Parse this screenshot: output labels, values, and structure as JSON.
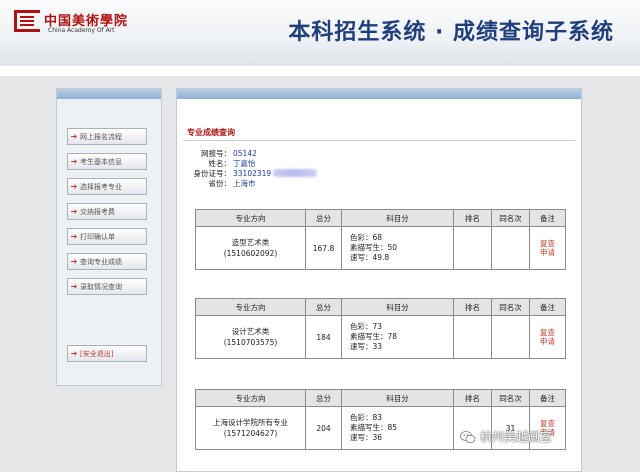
{
  "header": {
    "logo_cn": "中国美術學院",
    "logo_en": "China Academy Of Art",
    "system_title": "本科招生系统 · 成绩查询子系统"
  },
  "sidebar": {
    "items": [
      {
        "label": "网上报名流程"
      },
      {
        "label": "考生基本信息"
      },
      {
        "label": "选择报考专业"
      },
      {
        "label": "交纳报考费"
      },
      {
        "label": "打印确认单"
      },
      {
        "label": "查询专业成绩"
      },
      {
        "label": "录取情况查询"
      }
    ],
    "logout_label": "[安全退出]"
  },
  "main": {
    "section_title": "专业成绩查询",
    "info": {
      "exam_no_label": "网报号：",
      "exam_no": "05142",
      "name_label": "姓名：",
      "name": "丁嘉怡",
      "id_label": "身份证号：",
      "id_visible": "33102319",
      "province_label": "省份：",
      "province": "上海市"
    },
    "table_headers": [
      "专业方向",
      "总分",
      "科目分",
      "排名",
      "同名次",
      "备注"
    ],
    "tables": [
      {
        "direction": "造型艺术类",
        "code": "(1510602092)",
        "total": "167.8",
        "subjects": [
          "色彩：68",
          "素描写生：50",
          "速写：49.8"
        ],
        "rank": "",
        "tie": "",
        "note_line1": "复查",
        "note_line2": "申请"
      },
      {
        "direction": "设计艺术类",
        "code": "(1510703575)",
        "total": "184",
        "subjects": [
          "色彩：73",
          "素描写生：78",
          "速写：33"
        ],
        "rank": "",
        "tie": "",
        "note_line1": "复查",
        "note_line2": "申请"
      },
      {
        "direction": "上海设计学院所有专业",
        "code": "(1571204627)",
        "total": "204",
        "subjects": [
          "色彩：83",
          "素描写生：85",
          "速写：36"
        ],
        "rank": "",
        "tie": "31",
        "note_line1": "复查",
        "note_line2": "申请"
      }
    ]
  },
  "watermark": {
    "text": "杭州美越画室"
  }
}
